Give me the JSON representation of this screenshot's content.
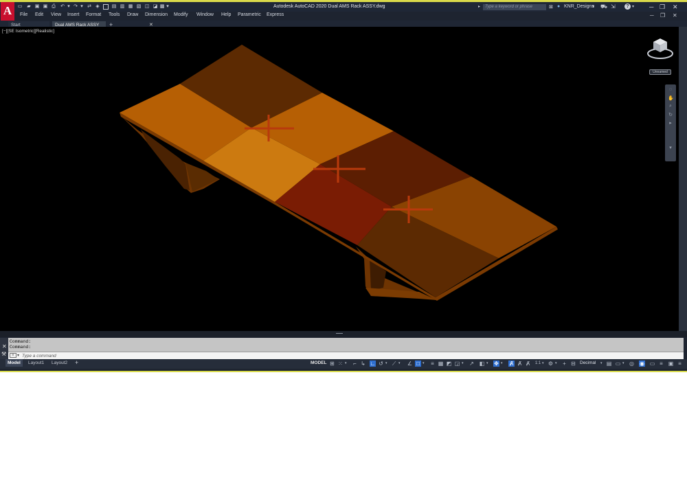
{
  "title_bar": {
    "app_logo": "A",
    "title": "Autodesk AutoCAD 2020    Dual AMS Rack ASSY.dwg",
    "search_placeholder": "Type a keyword or phrase",
    "user_name": "KNR_Designs",
    "help_label": "?"
  },
  "menu": {
    "items": [
      "File",
      "Edit",
      "View",
      "Insert",
      "Format",
      "Tools",
      "Draw",
      "Dimension",
      "Modify",
      "Window",
      "Help",
      "Parametric",
      "Express"
    ]
  },
  "file_tabs": {
    "tabs": [
      {
        "label": "Start"
      },
      {
        "label": "Dual AMS Rack ASSY"
      }
    ],
    "close_glyph": "✕",
    "add_glyph": "+"
  },
  "viewport": {
    "view_label": "[−][SE Isometric][Realistic]",
    "wcs_label": "Unnamed",
    "viewcube_compass": "N",
    "model_colors": {
      "light": "#b65f04",
      "mid": "#8a4302",
      "dark": "#5c2a02",
      "red": "#7a1c04",
      "highlight": "#cc7a10",
      "gizmo": "#b83a0c"
    }
  },
  "command": {
    "history": [
      "Command:",
      "Command:"
    ],
    "input_placeholder": "Type a command"
  },
  "status_bar": {
    "layout_tabs": [
      "Model",
      "Layout1",
      "Layout2"
    ],
    "add_layout": "+",
    "model_label": "MODEL",
    "units_label": "Decimal",
    "scale_label": "1:1"
  },
  "icons": {
    "quick_access": [
      "new-icon",
      "open-icon",
      "save-icon",
      "save-as-icon",
      "plot-icon",
      "undo-icon",
      "redo-icon"
    ],
    "status": [
      "grid-icon",
      "snap-icon",
      "ortho-icon",
      "polar-icon",
      "isodraft-icon",
      "osnap-icon",
      "lineweight-icon",
      "transparency-icon",
      "selection-cycling-icon",
      "3d-osnap-icon",
      "ucs-icon",
      "gizmo-icon",
      "annotation-scale-icon",
      "workspace-gear-icon",
      "plus-icon",
      "hardware-accel-icon",
      "isolate-icon",
      "clean-screen-icon",
      "customize-icon"
    ]
  }
}
